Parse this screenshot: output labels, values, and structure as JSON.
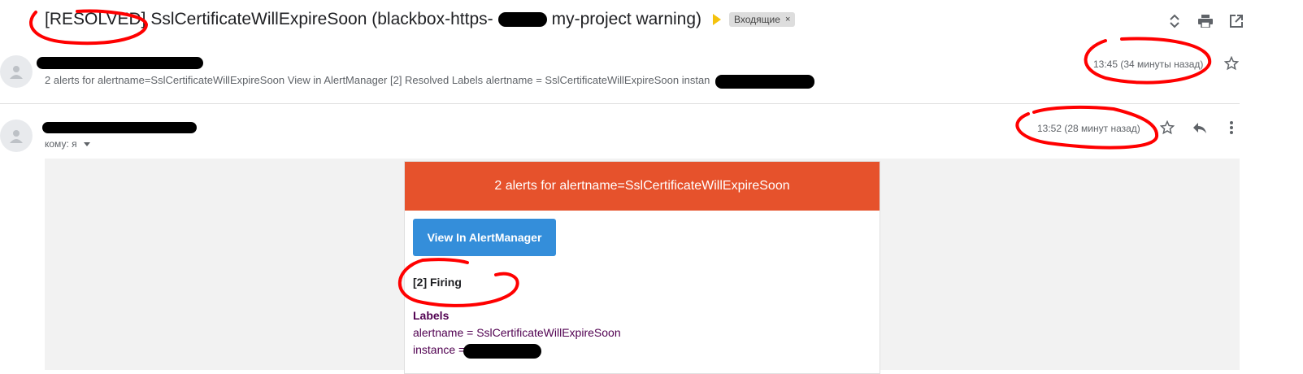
{
  "subject": {
    "prefix": "[RESOLVED] SslCertificateWillExpireSoon (blackbox-https-",
    "suffix": " my-project warning)",
    "label_chip": "Входящие",
    "label_close": "×"
  },
  "toolbar_icons": [
    "expand-collapse-icon",
    "print-icon",
    "open-in-new-window-icon"
  ],
  "message1": {
    "snippet": "2 alerts for alertname=SslCertificateWillExpireSoon View in AlertManager [2] Resolved Labels alertname = SslCertificateWillExpireSoon instan",
    "time": "13:45 (34 минуты назад)"
  },
  "message2": {
    "time": "13:52 (28 минут назад)",
    "to": "кому: я"
  },
  "email_body": {
    "header": "2 alerts for alertname=SslCertificateWillExpireSoon",
    "button": "View In AlertManager",
    "firing": "[2] Firing",
    "labels_title": "Labels",
    "label1": "alertname = SslCertificateWillExpireSoon",
    "label2": "instance = "
  },
  "colors": {
    "alert_header": "#e6522c",
    "button": "#348eda",
    "annotation": "#ff0000",
    "label_text": "#500050"
  }
}
